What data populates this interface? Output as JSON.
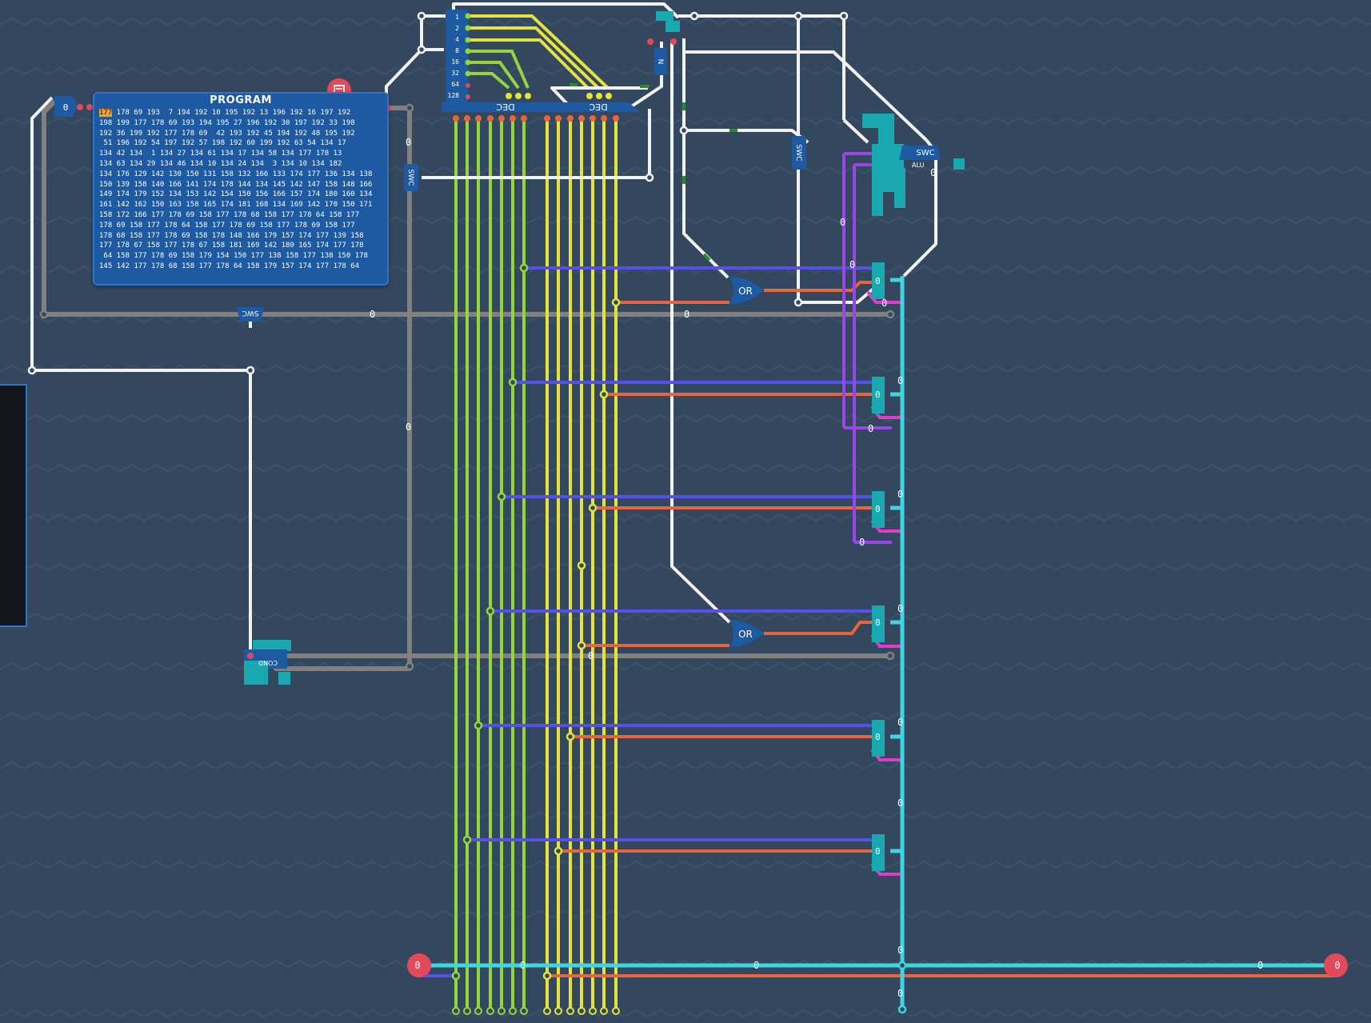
{
  "program": {
    "title": "PROGRAM",
    "highlight": "177",
    "rows": [
      "178 69 193  7 194 192 10 195 192 13 196 192 16 197 192",
      "198 199 177 178 69 193 194 195 27 196 192 30 197 192 33 198",
      "192 36 199 192 177 178 69  42 193 192 45 194 192 48 195 192",
      " 51 196 192 54 197 192 57 198 192 60 199 192 63 54 134 17",
      "134 42 134  1 134 27 134 61 134 17 134 58 134 177 178 13",
      "134 63 134 29 134 46 134 10 134 24 134  3 134 10 134 182",
      "134 176 129 142 130 150 131 158 132 166 133 174 177 136 134 138",
      "150 139 158 140 166 141 174 178 144 134 145 142 147 158 148 166",
      "149 174 179 152 134 153 142 154 150 156 166 157 174 180 160 134",
      "161 142 162 150 163 158 165 174 181 168 134 169 142 170 150 171",
      "158 172 166 177 178 69 158 177 178 68 158 177 178 64 158 177",
      "178 69 158 177 178 64 158 177 178 69 158 177 178 69 158 177",
      "178 68 158 177 178 69 158 178 148 166 179 157 174 177 139 158",
      "177 178 67 158 177 178 67 158 181 169 142 180 165 174 177 178",
      " 64 158 177 178 69 158 179 154 150 177 138 158 177 138 150 178",
      "145 142 177 178 68 158 177 178 64 158 179 157 174 177 178 64"
    ]
  },
  "labels": {
    "dec": "DEC",
    "or": "OR",
    "swc": "SWC",
    "cond": "COND",
    "alu": "ALU",
    "zero": "0",
    "bits": [
      "1",
      "2",
      "4",
      "8",
      "16",
      "32",
      "64",
      "128"
    ]
  },
  "colors": {
    "background": "#33475e",
    "white_wire": "#f2f2f2",
    "gray_wire": "#808080",
    "green_wire": "#93d53b",
    "yellow_wire": "#e3e33b",
    "blue_wire": "#5550e6",
    "orange_wire": "#e8643c",
    "cyan_wire": "#3fd6e0",
    "purple_wire": "#9a45e6",
    "magenta_wire": "#e03ccc",
    "component": "#1e5aa2",
    "teal": "#1aa8b0",
    "pin_red": "#e24a5b"
  }
}
